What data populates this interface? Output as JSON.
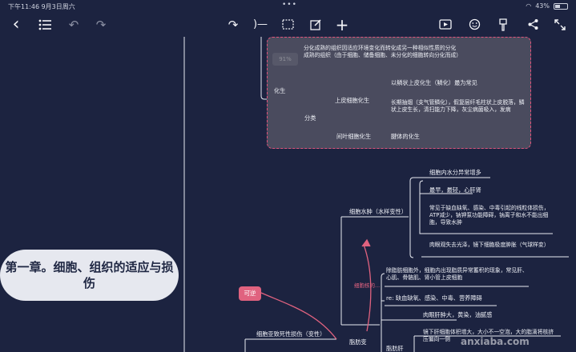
{
  "status_bar": {
    "time": "下午11:46  9月3日周六",
    "battery": "43%"
  },
  "toolbar": {
    "back_glyph": "‹",
    "add_glyph": "+",
    "icons": [
      "chevron-left-icon",
      "outline-list-icon",
      "undo-icon",
      "redo-icon",
      "relation-link-icon",
      "summary-bracket-icon",
      "frame-icon",
      "note-edit-icon",
      "add-icon",
      "presentation-play-icon",
      "emoji-icon",
      "format-brush-icon",
      "share-icon",
      "fullscreen-icon"
    ]
  },
  "mindmap": {
    "root": "第一章。细胞、组织的适应与损伤",
    "relation_badge": "可逆",
    "selection_percent": "91%",
    "watermark": "anxiaba.com",
    "nodes": {
      "metaplasia": "化生",
      "metaplasia_desc": "分化成熟的组织因适应环境变化而转化成另一种相似性质的分化成熟的组织（由于细胞、储备细胞、未分化的细胞转向分化而成）",
      "classification": "分类",
      "epithelial": "上皮细胞化生",
      "squamous": "以鳞状上皮化生（鳞化）最为常见",
      "smoking": "长期抽烟（支气管鳞化），假复层纤毛柱状上皮脱落，鳞状上皮生长，清扫能力下降，灰尘病菌吸入，发病",
      "mesenchymal": "间叶细胞化生",
      "osseous": "腱体的化生",
      "hydropic": "细胞水肿（水样变性）",
      "endocrine": "细胞内水分异常增多",
      "common_sites": "最早，最轻，心肝肾",
      "causes": "常见于缺血缺氧、感染、中毒引起的线粒体损伤，ATP减少，钠钾泵功能障碍，钠离子和水不能出细胞，导致水肿",
      "gross": "肉眼观失去光泽，镜下细胞极度肿胀（气球样变）",
      "fatty": "脂肪变",
      "fatty_desc": "除脂肪细胞外，细胞内出现脂质异常蓄积的现象，常见肝、心肌、骨骼肌、肾小管上皮细胞",
      "fatty_causes": "re: 缺血缺氧、感染、中毒、营养障碍",
      "fatty_gross": "肉眼肝肿大，黄染，油腻感",
      "fatty_liver": "脂肪肝",
      "fatty_micro": "镜下肝细胞体积增大，大小不一空泡，大的脂滴将核挤压偏向一侧",
      "degeneration": "细胞亚致死性损伤（变性）",
      "relation_label": "细胞核的..."
    }
  }
}
